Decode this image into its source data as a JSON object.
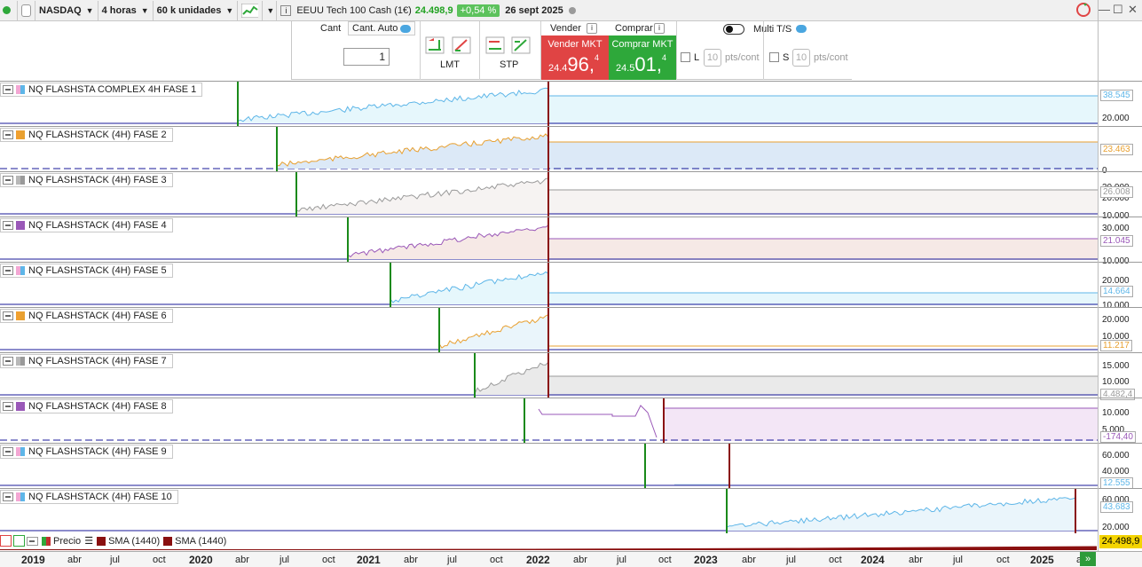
{
  "toolbar": {
    "market": "NASDAQ",
    "timeframe": "4 horas",
    "units": "60 k unidades",
    "quote_title": "EEUU Tech 100 Cash (1€)",
    "quote_price": "24.498,9",
    "quote_change": "+0,54 %",
    "quote_date": "26 sept 2025"
  },
  "ticket": {
    "cant_label": "Cant",
    "cant_auto_label": "Cant. Auto",
    "cant_value": "1",
    "lmt_label": "LMT",
    "stp_label": "STP",
    "sell_label": "Vender",
    "buy_label": "Comprar",
    "sell_mkt_label": "Vender MKT",
    "buy_mkt_label": "Comprar MKT",
    "sell_price_prefix": "24.4",
    "sell_price_main": "96,",
    "sell_price_sup": "4",
    "buy_price_prefix": "24.5",
    "buy_price_main": "01,",
    "buy_price_sup": "4",
    "multi_ts_label": "Multi T/S",
    "l_label": "L",
    "s_label": "S",
    "pts_value": "10",
    "pts_unit": "pts/cont"
  },
  "panels": [
    {
      "title": "NQ FLASHSTA COMPLEX 4H FASE 1",
      "value": "38.545",
      "ticks": [
        "20.000"
      ],
      "color": "#5eb6e8",
      "swatch": "#f2a7d4"
    },
    {
      "title": "NQ FLASHSTACK (4H) FASE 2",
      "value": "23.463",
      "ticks": [
        "0"
      ],
      "color": "#e8a030",
      "swatch": "#f0a030"
    },
    {
      "title": "NQ FLASHSTACK (4H) FASE 3",
      "value": "26.008",
      "ticks": [
        "30.000",
        "20.000",
        "10.000"
      ],
      "color": "#9a9a9a",
      "swatch": "#b8b8b8"
    },
    {
      "title": "NQ FLASHSTACK (4H) FASE 4",
      "value": "21.045",
      "ticks": [
        "30.000",
        "10.000"
      ],
      "color": "#9a58b8",
      "swatch": "#9a58b8"
    },
    {
      "title": "NQ FLASHSTACK (4H) FASE 5",
      "value": "14.664",
      "ticks": [
        "20.000",
        "10.000"
      ],
      "color": "#5eb6e8",
      "swatch": "#f2a7d4"
    },
    {
      "title": "NQ FLASHSTACK (4H) FASE 6",
      "value": "11.217",
      "ticks": [
        "20.000",
        "10.000"
      ],
      "color": "#e8a030",
      "swatch": "#f0a030"
    },
    {
      "title": "NQ FLASHSTACK (4H) FASE 7",
      "value": "4.482,4",
      "ticks": [
        "15.000",
        "10.000",
        "5.000"
      ],
      "color": "#9a9a9a",
      "swatch": "#b8b8b8"
    },
    {
      "title": "NQ FLASHSTACK (4H) FASE 8",
      "value": "-174,40",
      "ticks": [
        "10.000",
        "5.000"
      ],
      "color": "#9a58b8",
      "swatch": "#9a58b8"
    },
    {
      "title": "NQ FLASHSTACK (4H) FASE 9",
      "value": "12.555",
      "ticks": [
        "60.000",
        "40.000"
      ],
      "color": "#5eb6e8",
      "swatch": "#f2a7d4"
    },
    {
      "title": "NQ FLASHSTACK (4H) FASE 10",
      "value": "43.683",
      "ticks": [
        "60.000",
        "20.000"
      ],
      "color": "#5eb6e8",
      "swatch": "#f2a7d4"
    }
  ],
  "legend": {
    "items": [
      "Precio",
      "SMA (1440)",
      "SMA (1440)"
    ],
    "price_value": "24.498,9"
  },
  "xaxis": {
    "labels": [
      "2019",
      "abr",
      "jul",
      "oct",
      "2020",
      "abr",
      "jul",
      "oct",
      "2021",
      "abr",
      "jul",
      "oct",
      "2022",
      "abr",
      "jul",
      "oct",
      "2023",
      "abr",
      "jul",
      "oct",
      "2024",
      "abr",
      "jul",
      "oct",
      "2025",
      "a"
    ]
  }
}
